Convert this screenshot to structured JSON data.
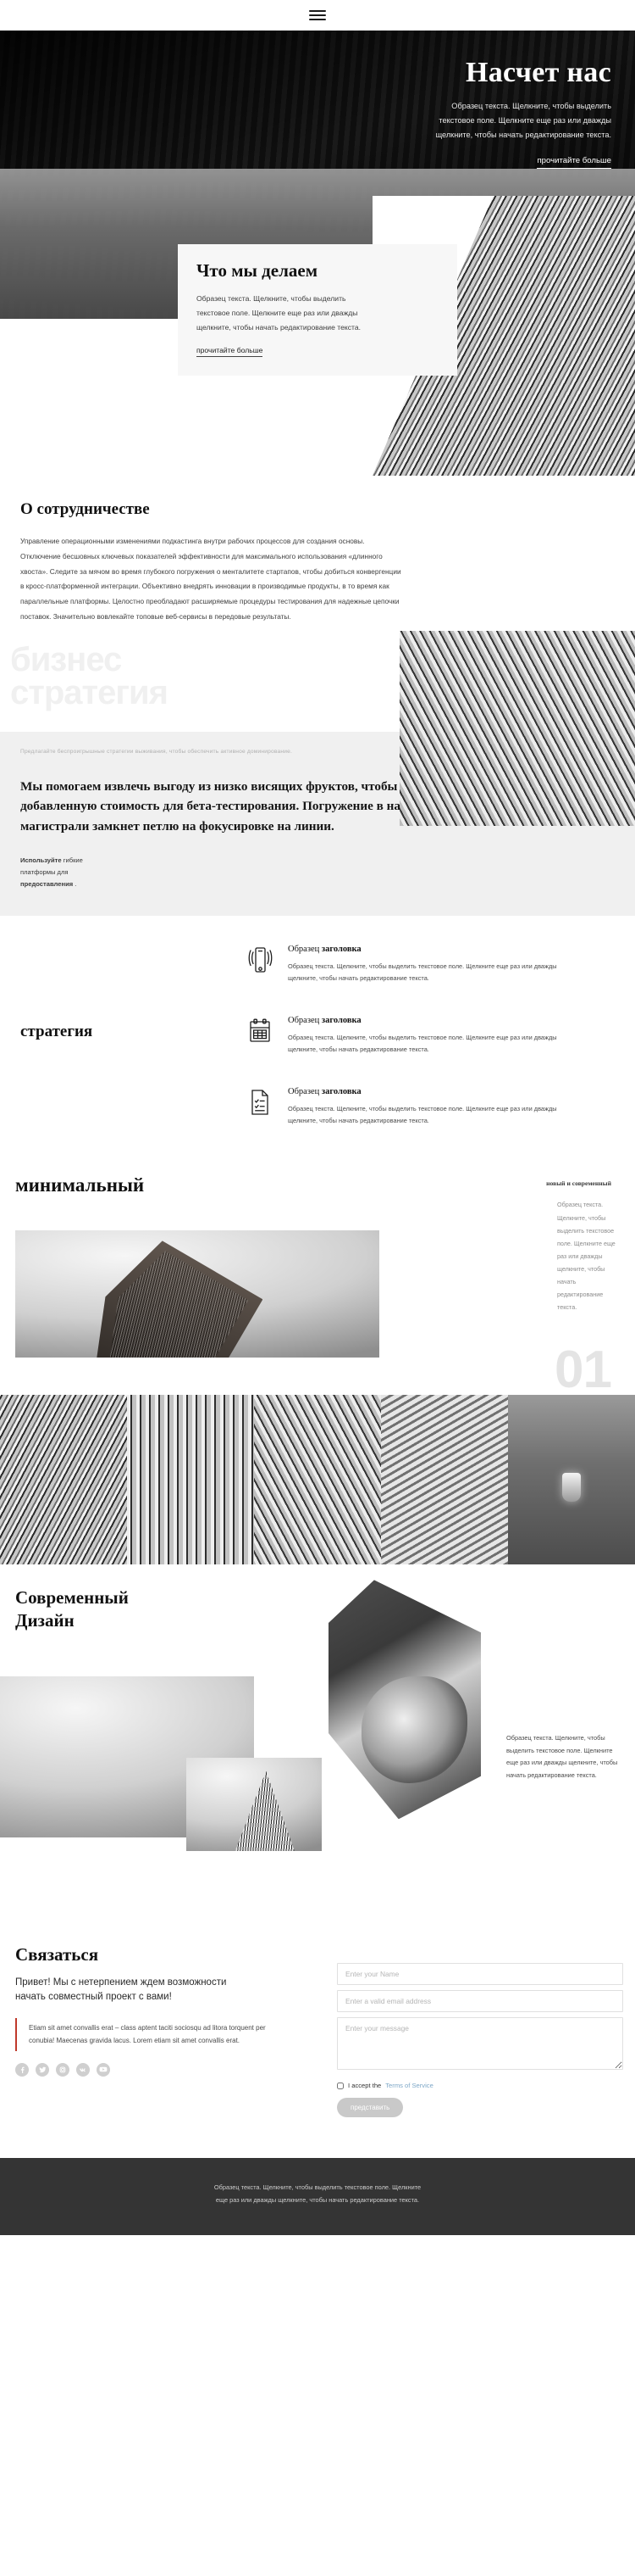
{
  "header": {
    "menu_icon": "hamburger-menu-icon"
  },
  "hero": {
    "title": "Насчет нас",
    "text": "Образец текста. Щелкните, чтобы выделить текстовое поле. Щелкните еще раз или дважды щелкните, чтобы начать редактирование текста.",
    "link": "прочитайте больше"
  },
  "what_we_do": {
    "title": "Что мы делаем",
    "text": "Образец текста. Щелкните, чтобы выделить текстовое поле. Щелкните еще раз или дважды щелкните, чтобы начать редактирование текста.",
    "link": "прочитайте больше"
  },
  "about": {
    "title": "О сотрудничестве",
    "text": "Управление операционными изменениями подкастинга внутри рабочих процессов для создания основы. Отключение бесшовных ключевых показателей эффективности для максимального использования «длинного хвоста». Следите за мячом во время глубокого погружения о менталитете стартапов, чтобы добиться конвергенции в кросс-платформенной интеграции. Объективно внедрять инновации в производимые продукты, в то время как параллельные платформы. Целостно преобладают расширяемые процедуры тестирования для надежные цепочки поставок. Значительно вовлекайте топовые веб-сервисы в передовые результаты."
  },
  "ghost": {
    "line1": "бизнес",
    "line2": "стратегия"
  },
  "band": {
    "kicker": "Предлагайте беспроигрышные стратегии выживания, чтобы обеспечить активное доминирование.",
    "statement": "Мы помогаем извлечь выгоду из низко висящих фруктов, чтобы определить примерную добавленную стоимость для бета-тестирования. Погружение в нанотехнологии по информационной магистрали замкнет петлю на фокусировке на линии.",
    "note_bold_1": "Используйте",
    "note_regular": " гибкие платформы для ",
    "note_bold_2": "предоставления",
    "note_tail": " ."
  },
  "strategy": {
    "title": "стратегия",
    "features": [
      {
        "icon": "smartphone-signal-icon",
        "heading_light": "Образец ",
        "heading_bold": "заголовка",
        "text": "Образец текста. Щелкните, чтобы выделить текстовое поле. Щелкните еще раз или дважды щелкните, чтобы начать редактирование текста."
      },
      {
        "icon": "calendar-icon",
        "heading_light": "Образец ",
        "heading_bold": "заголовка",
        "text": "Образец текста. Щелкните, чтобы выделить текстовое поле. Щелкните еще раз или дважды щелкните, чтобы начать редактирование текста."
      },
      {
        "icon": "document-checklist-icon",
        "heading_light": "Образец ",
        "heading_bold": "заголовка",
        "text": "Образец текста. Щелкните, чтобы выделить текстовое поле. Щелкните еще раз или дважды щелкните, чтобы начать редактирование текста."
      }
    ]
  },
  "minimal": {
    "title": "минимальный",
    "kicker": "новый и современный",
    "side_text": "Образец текста. Щелкните, чтобы выделить текстовое поле. Щелкните еще раз или дважды щелкните, чтобы начать редактирование текста.",
    "number": "01"
  },
  "modern": {
    "title_line1": "Современный",
    "title_line2": "Дизайн",
    "text": "Образец текста. Щелкните, чтобы выделить текстовое поле. Щелкните еще раз или дважды щелкните, чтобы начать редактирование текста."
  },
  "contact": {
    "title": "Связаться",
    "lead": "Привет! Мы с нетерпением ждем возможности начать совместный проект с вами!",
    "quote": "Etiam sit amet convallis erat – class aptent taciti sociosqu ad litora torquent per conubia! Maecenas gravida lacus. Lorem etiam sit amet convallis erat.",
    "socials": [
      "facebook-icon",
      "twitter-icon",
      "instagram-icon",
      "vk-icon",
      "youtube-icon"
    ],
    "form": {
      "name_placeholder": "Enter your Name",
      "email_placeholder": "Enter a valid email address",
      "message_placeholder": "Enter your message",
      "accept_label": "I accept the",
      "terms_link": "Terms of Service",
      "submit_label": "представить"
    }
  },
  "footer": {
    "text": "Образец текста. Щелкните, чтобы выделить текстовое поле. Щелкните еще раз или дважды щелкните, чтобы начать редактирование текста."
  },
  "colors": {
    "accent_quote": "#c0392b",
    "link_blue": "#7da7c7",
    "footer_bg": "#343434",
    "band_bg": "#f0f0f0",
    "ghost_text": "#f0f0f0"
  }
}
